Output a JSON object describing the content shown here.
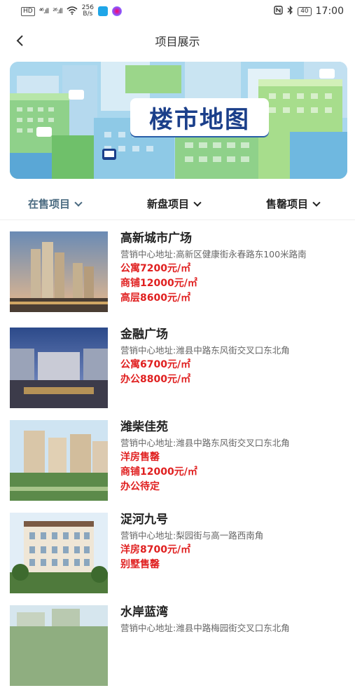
{
  "status_bar": {
    "badge": "HD",
    "signal1": "⁴⁶.ıll",
    "signal2": "²⁶.ıll",
    "speed_value": "256",
    "speed_unit": "B/s",
    "battery": "40",
    "time": "17:00"
  },
  "header": {
    "title": "项目展示"
  },
  "banner": {
    "title": "楼市地图"
  },
  "tabs": [
    {
      "label": "在售项目",
      "active": true
    },
    {
      "label": "新盘项目",
      "active": false
    },
    {
      "label": "售罄项目",
      "active": false
    }
  ],
  "projects": [
    {
      "name": "高新城市广场",
      "address": "营销中心地址:高新区健康街永春路东100米路南",
      "prices": [
        "公寓7200元/㎡",
        "商铺12000元/㎡",
        "高层8600元/㎡"
      ]
    },
    {
      "name": "金融广场",
      "address": "营销中心地址:潍县中路东风街交叉口东北角",
      "prices": [
        "公寓6700元/㎡",
        "办公8800元/㎡"
      ]
    },
    {
      "name": "潍柴佳苑",
      "address": "营销中心地址:潍县中路东风街交叉口东北角",
      "prices": [
        "洋房售罄",
        "商铺12000元/㎡",
        "办公待定"
      ]
    },
    {
      "name": "浞河九号",
      "address": "营销中心地址:梨园街与高一路西南角",
      "prices": [
        "洋房8700元/㎡",
        "别墅售罄"
      ]
    },
    {
      "name": "水岸蓝湾",
      "address": "营销中心地址:潍县中路梅园街交叉口东北角",
      "prices": []
    }
  ],
  "colors": {
    "price": "#e02020",
    "active_tab": "#4a6a80"
  }
}
